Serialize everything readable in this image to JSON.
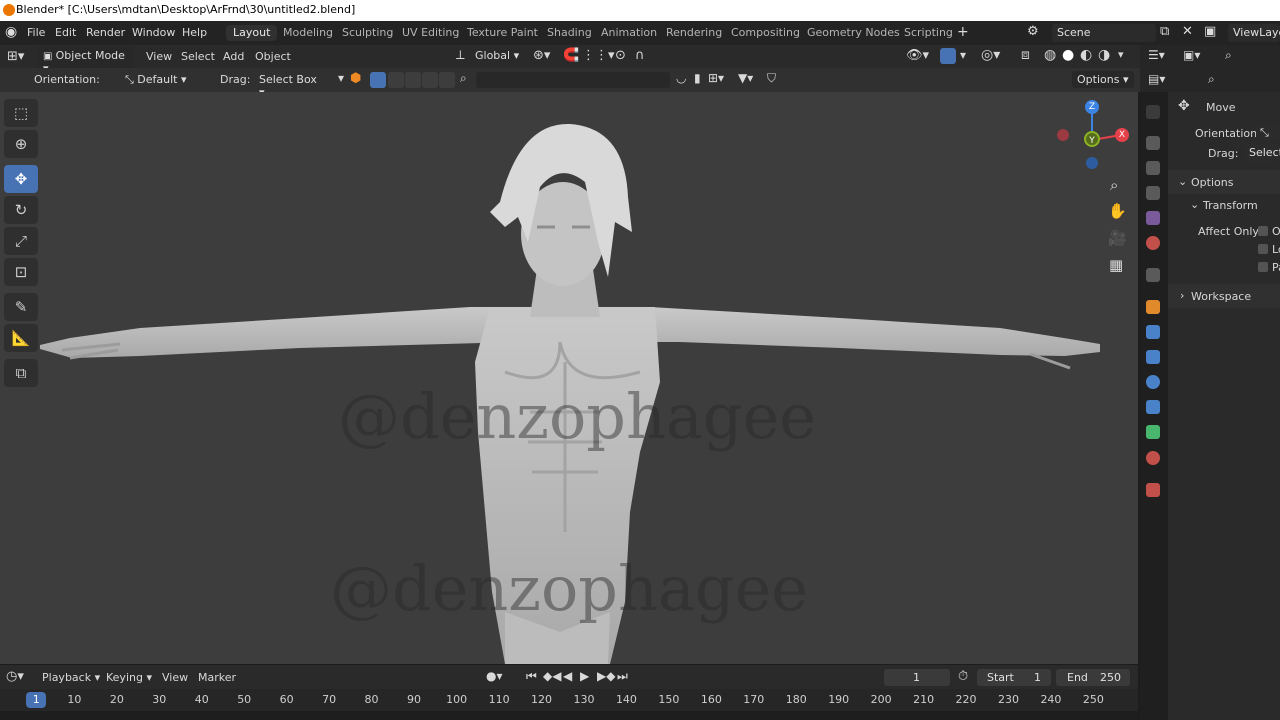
{
  "window": {
    "title": "Blender* [C:\\Users\\mdtan\\Desktop\\ArFrnd\\30\\untitled2.blend]"
  },
  "menu": {
    "items": [
      "File",
      "Edit",
      "Render",
      "Window",
      "Help"
    ],
    "workspaces": [
      "Layout",
      "Modeling",
      "Sculpting",
      "UV Editing",
      "Texture Paint",
      "Shading",
      "Animation",
      "Rendering",
      "Compositing",
      "Geometry Nodes",
      "Scripting"
    ],
    "active_workspace": "Layout",
    "add_workspace": "+",
    "scene": "Scene",
    "view_layer": "ViewLaye"
  },
  "viewport_header": {
    "mode": "Object Mode",
    "menus": [
      "View",
      "Select",
      "Add",
      "Object"
    ],
    "transform_orientation": "Global",
    "options_label": "Options"
  },
  "tool_settings": {
    "orientation_label": "Orientation:",
    "orientation_value": "Default",
    "drag_label": "Drag:",
    "drag_value": "Select Box"
  },
  "gizmo": {
    "z": "Z",
    "x": "X",
    "y": "Y"
  },
  "watermarks": [
    "@denzophagee",
    "@denzophagee"
  ],
  "properties": {
    "tool_name": "Move",
    "orientation_label": "Orientation",
    "drag_label": "Drag:",
    "drag_value": "Select",
    "options_label": "Options",
    "transform_label": "Transform",
    "affect_only_label": "Affect Only",
    "affect_options": [
      "O",
      "Lo",
      "Pa"
    ],
    "workspace_label": "Workspace"
  },
  "timeline": {
    "menus": [
      "Playback",
      "Keying",
      "View",
      "Marker"
    ],
    "current_frame": "1",
    "start_label": "Start",
    "start_value": "1",
    "end_label": "End",
    "end_value": "250",
    "frame_marks": [
      "1",
      "10",
      "20",
      "30",
      "40",
      "50",
      "60",
      "70",
      "80",
      "90",
      "100",
      "110",
      "120",
      "130",
      "140",
      "150",
      "160",
      "170",
      "180",
      "190",
      "200",
      "210",
      "220",
      "230",
      "240",
      "250"
    ]
  },
  "colors": {
    "accent": "#4772b3",
    "viewport_bg": "#3d3d3d",
    "axis_x": "#e5414b",
    "axis_y": "#8cb324",
    "axis_z": "#3c84e4"
  }
}
